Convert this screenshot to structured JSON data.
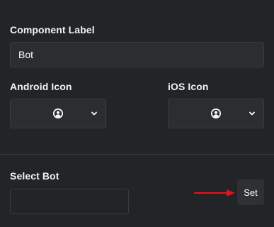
{
  "component_label": {
    "title": "Component Label",
    "value": "Bot"
  },
  "android_icon": {
    "title": "Android Icon",
    "selected_icon": "user-circle-icon"
  },
  "ios_icon": {
    "title": "iOS Icon",
    "selected_icon": "user-circle-icon"
  },
  "select_bot": {
    "title": "Select Bot",
    "value": "",
    "button_label": "Set"
  },
  "colors": {
    "background": "#232427",
    "field_background": "#2c2d31",
    "border": "#3a3b40",
    "annotation_arrow": "#e0141b"
  }
}
